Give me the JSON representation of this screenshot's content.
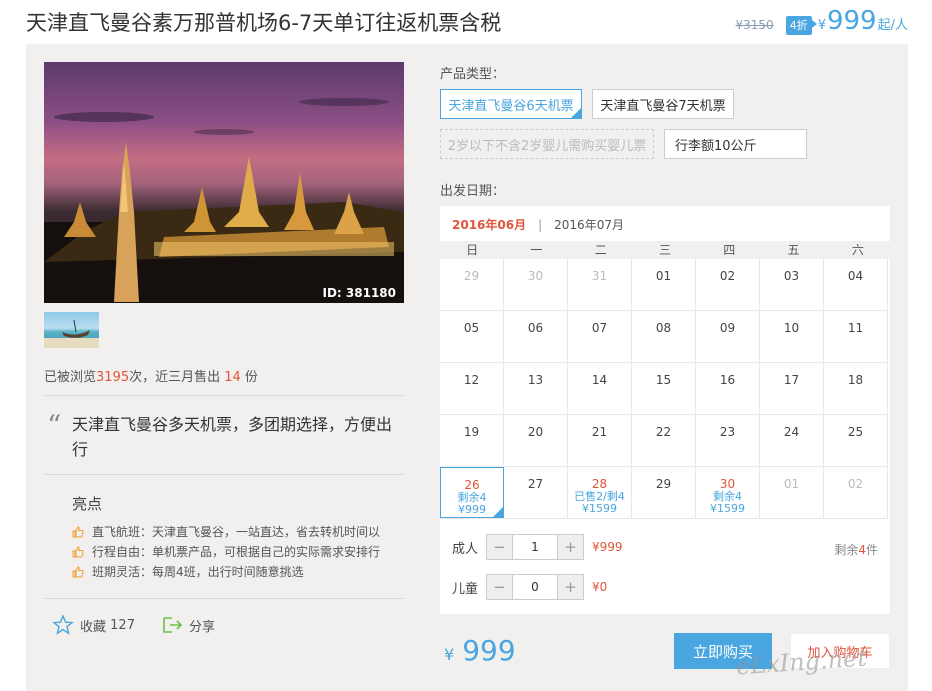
{
  "header": {
    "title": "天津直飞曼谷素万那普机场6-7天单订往返机票含税",
    "old_price": "¥3150",
    "discount": "4折",
    "yen": "¥",
    "price": "999",
    "unit": "起/人"
  },
  "gallery": {
    "photo_id": "ID: 381180"
  },
  "stats": {
    "prefix": "已被浏览",
    "views": "3195",
    "middle": "次，近三月售出 ",
    "sold": "14",
    "suffix": " 份"
  },
  "description": {
    "quote": "天津直飞曼谷多天机票，多团期选择，方便出行"
  },
  "highlights": {
    "title": "亮点",
    "items": [
      "直飞航班：天津直飞曼谷，一站直达，省去转机时间以",
      "行程自由：单机票产品，可根据自己的实际需求安排行",
      "班期灵活：每周4班，出行时间随意挑选"
    ]
  },
  "actions": {
    "favorite_label": "收藏",
    "favorite_count": "127",
    "share_label": "分享"
  },
  "product_type": {
    "label": "产品类型：",
    "options": [
      {
        "label": "天津直飞曼谷6天机票",
        "state": "selected"
      },
      {
        "label": "天津直飞曼谷7天机票",
        "state": "normal"
      },
      {
        "label": "2岁以下不含2岁婴儿需购买婴儿票",
        "state": "disabled"
      },
      {
        "label": "行李额10公斤",
        "state": "normal"
      }
    ]
  },
  "calendar": {
    "label": "出发日期：",
    "month_active": "2016年06月",
    "separator": "|",
    "month_next": "2016年07月",
    "weekdays": [
      "日",
      "一",
      "二",
      "三",
      "四",
      "五",
      "六"
    ],
    "weeks": [
      [
        {
          "d": "29",
          "g": 1
        },
        {
          "d": "30",
          "g": 1
        },
        {
          "d": "31",
          "g": 1
        },
        {
          "d": "01"
        },
        {
          "d": "02"
        },
        {
          "d": "03"
        },
        {
          "d": "04"
        }
      ],
      [
        {
          "d": "05"
        },
        {
          "d": "06"
        },
        {
          "d": "07"
        },
        {
          "d": "08"
        },
        {
          "d": "09"
        },
        {
          "d": "10"
        },
        {
          "d": "11"
        }
      ],
      [
        {
          "d": "12"
        },
        {
          "d": "13"
        },
        {
          "d": "14"
        },
        {
          "d": "15"
        },
        {
          "d": "16"
        },
        {
          "d": "17"
        },
        {
          "d": "18"
        }
      ],
      [
        {
          "d": "19"
        },
        {
          "d": "20"
        },
        {
          "d": "21"
        },
        {
          "d": "22"
        },
        {
          "d": "23"
        },
        {
          "d": "24"
        },
        {
          "d": "25"
        }
      ],
      [
        {
          "d": "26",
          "r": 1,
          "sel": 1,
          "l1": "剩余4",
          "l2": "¥999"
        },
        {
          "d": "27"
        },
        {
          "d": "28",
          "r": 1,
          "l1": "已售2/剩4",
          "l2": "¥1599"
        },
        {
          "d": "29"
        },
        {
          "d": "30",
          "r": 1,
          "l1": "剩余4",
          "l2": "¥1599"
        },
        {
          "d": "01",
          "g": 1
        },
        {
          "d": "02",
          "g": 1
        }
      ]
    ]
  },
  "quantity": {
    "adult_label": "成人",
    "adult_value": "1",
    "adult_price": "¥999",
    "child_label": "儿童",
    "child_value": "0",
    "child_price": "¥0",
    "minus": "−",
    "plus": "+",
    "remain_prefix": "剩余",
    "remain_count": "4",
    "remain_suffix": "件"
  },
  "footer": {
    "yen": "¥",
    "total": "999",
    "buy_label": "立即购买",
    "cart_label": "加入购物车",
    "watermark": "eLxIng.net"
  },
  "colors": {
    "accent": "#4aa6e0",
    "red": "#e0553b",
    "panel": "#f1f0ef"
  }
}
